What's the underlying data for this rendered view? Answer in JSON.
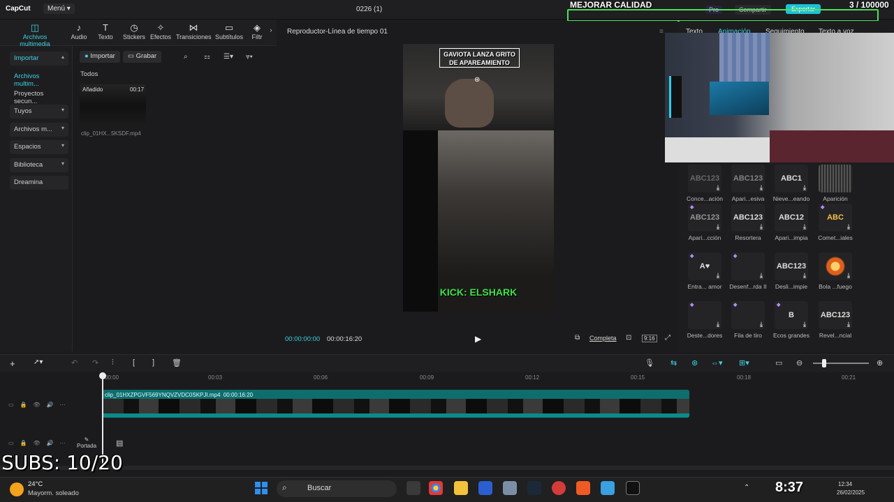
{
  "app": {
    "logo": "CapCut",
    "menu_label": "Menú",
    "project_title": "0226 (1)",
    "pro_label": "Pro",
    "share_label": "Compartir",
    "export_label": "Exportar"
  },
  "overlay": {
    "title": "MEJORAR CALIDAD",
    "count": "3 / 100000",
    "subs": "SUBS: 10/20"
  },
  "toolbar": {
    "items": [
      {
        "label": "Archivos multimedia",
        "icon": "media-icon"
      },
      {
        "label": "Audio",
        "icon": "audio-icon"
      },
      {
        "label": "Texto",
        "icon": "text-icon"
      },
      {
        "label": "Stickers",
        "icon": "sticker-icon"
      },
      {
        "label": "Efectos",
        "icon": "effects-icon"
      },
      {
        "label": "Transiciones",
        "icon": "transition-icon"
      },
      {
        "label": "Subtítulos",
        "icon": "subtitle-icon"
      },
      {
        "label": "Filtr",
        "icon": "filter-icon"
      }
    ]
  },
  "leftnav": {
    "items": [
      {
        "label": "Importar"
      },
      {
        "label": "Archivos multim..."
      },
      {
        "label": "Proyectos secun..."
      },
      {
        "label": "Tuyos"
      },
      {
        "label": "Archivos m..."
      },
      {
        "label": "Espacios"
      },
      {
        "label": "Biblioteca"
      },
      {
        "label": "Dreamina"
      }
    ]
  },
  "media": {
    "import_label": "Importar",
    "record_label": "Grabar",
    "filter_all": "Todos",
    "clip": {
      "badge": "Añadido",
      "duration": "00:17",
      "name": "clip_01HX...5KSDF.mp4"
    }
  },
  "player": {
    "title": "Reproductor-Línea de tiempo 01",
    "caption": "GAVIOTA LANZA GRITO DE APAREAMIENTO",
    "kick": "KICK: ELSHARK",
    "time_current": "00:00:00:00",
    "time_total": "00:00:16:20",
    "full_label": "Completa",
    "ratio": "9:16"
  },
  "rightpanel": {
    "tabs": [
      "Texto",
      "Animación",
      "Seguimiento",
      "Texto a voz"
    ],
    "animations": [
      {
        "label": "Conce...ación",
        "preview": "ABC123"
      },
      {
        "label": "Apari...esiva",
        "preview": "ABC123"
      },
      {
        "label": "Nieve...eando",
        "preview": "ABC1"
      },
      {
        "label": "Aparición",
        "preview": ""
      },
      {
        "label": "Apari...cción",
        "preview": "ABC123"
      },
      {
        "label": "Resortera",
        "preview": "ABC123"
      },
      {
        "label": "Apari...impia",
        "preview": "ABC12"
      },
      {
        "label": "Comet...iales",
        "preview": "ABC"
      },
      {
        "label": "Entra... amor",
        "preview": "A♥"
      },
      {
        "label": "Desenf...rda II",
        "preview": ""
      },
      {
        "label": "Desli...impie",
        "preview": "ABC123"
      },
      {
        "label": "Bola ...fuego",
        "preview": ""
      },
      {
        "label": "Deste...dores",
        "preview": ""
      },
      {
        "label": "Fila de tiro",
        "preview": ""
      },
      {
        "label": "Ecos grandes",
        "preview": "B"
      },
      {
        "label": "Revel...ncial",
        "preview": "ABC123"
      }
    ]
  },
  "timeline": {
    "ticks": [
      "00:00",
      "00:03",
      "00:06",
      "00:09",
      "00:12",
      "00:15",
      "00:18",
      "00:21"
    ],
    "clip_name": "clip_01HXZPGVF569YNQVZVDC0SKPJI.mp4",
    "clip_duration": "00:00:16:20",
    "cover_label": "Portada"
  },
  "taskbar": {
    "temp": "24°C",
    "weather": "Mayorm. soleado",
    "search": "Buscar",
    "clock": "8:37",
    "time_small": "12:34",
    "date": "26/02/2025"
  }
}
